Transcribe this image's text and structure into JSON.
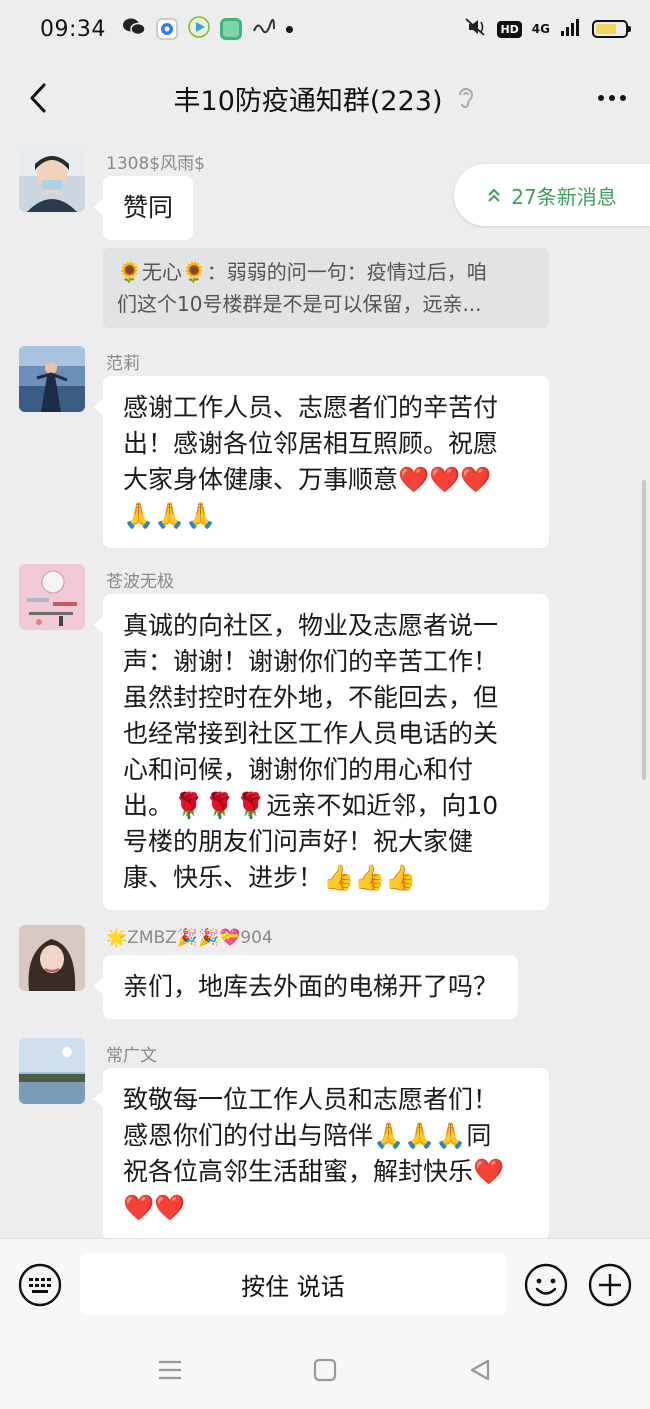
{
  "status_bar": {
    "time": "09:34",
    "hd": "HD",
    "signal": "4G"
  },
  "header": {
    "title": "丰10防疫通知群(223)"
  },
  "new_messages": {
    "label": "27条新消息"
  },
  "messages": [
    {
      "sender": "1308$风雨$",
      "lines": [
        "赞同"
      ]
    },
    {
      "sender": "范莉",
      "lines": [
        "感谢工作人员、志愿者们的辛苦付",
        "出！感谢各位邻居相互照顾。祝愿",
        "大家身体健康、万事顺意❤️❤️❤️",
        "🙏🙏🙏"
      ]
    },
    {
      "sender": "苍波无极",
      "lines": [
        "真诚的向社区，物业及志愿者说一",
        "声：谢谢！谢谢你们的辛苦工作！",
        "虽然封控时在外地，不能回去，但",
        "也经常接到社区工作人员电话的关",
        "心和问候，谢谢你们的用心和付",
        "出。🌹🌹🌹远亲不如近邻，向10",
        "号楼的朋友们问声好！祝大家健",
        "康、快乐、进步！👍👍👍"
      ]
    },
    {
      "sender": "🌟ZMBZ🎉🎉💝904",
      "lines": [
        "亲们，地库去外面的电梯开了吗？"
      ]
    },
    {
      "sender": "常广文",
      "lines": [
        "致敬每一位工作人员和志愿者们！",
        "感恩你们的付出与陪伴🙏🙏🙏同",
        "祝各位高邻生活甜蜜，解封快乐❤️",
        "❤️❤️"
      ]
    }
  ],
  "quote": {
    "lines": [
      "🌻无心🌻：弱弱的问一句：疫情过后，咱",
      "们这个10号楼群是不是可以保留，远亲..."
    ]
  },
  "input": {
    "voice_label": "按住 说话"
  },
  "colors": {
    "accent_green": "#3e9d5a",
    "background": "#ededed",
    "bubble": "#ffffff"
  }
}
